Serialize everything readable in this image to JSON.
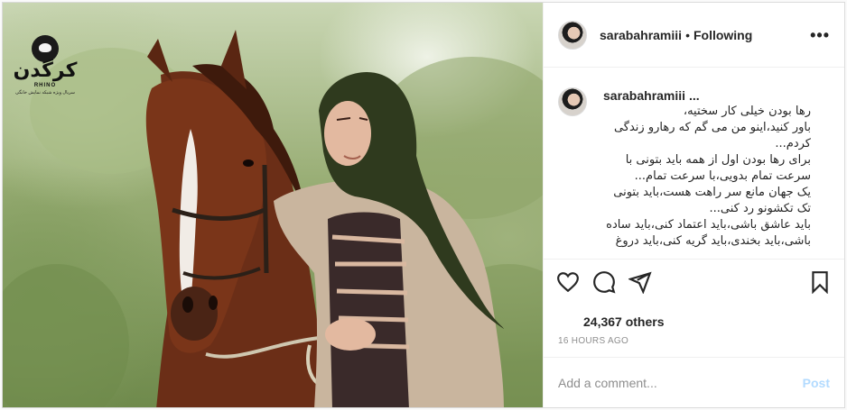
{
  "post": {
    "username": "sarabahramiii",
    "follow_status": "Following",
    "separator": "•",
    "more_icon": "more-horizontal-icon"
  },
  "logo": {
    "wordmark": "کرگدن",
    "subtitle": "RHINO",
    "tagline": "سریال ویژه شبکه نمایش خانگی"
  },
  "caption": {
    "username": "sarabahramiii ...",
    "lines": [
      "رها بودن خیلی کار سختیه،",
      "باور کنید،اینو من می گم که رهارو زندگی",
      "کردم...",
      "برای رها بودن اول از همه باید بتونی با",
      "سرعت تمام بدویی،با سرعت تمام...",
      "یک جهان مانع سر راهت هست،باید بتونی",
      "تک تکشونو رد کنی...",
      "باید عاشق باشی،باید اعتماد کنی،باید ساده",
      "باشی،باید بخندی،باید گریه کنی،باید دروغ"
    ]
  },
  "actions": {
    "like_icon": "heart-icon",
    "comment_icon": "comment-icon",
    "share_icon": "send-icon",
    "save_icon": "bookmark-icon"
  },
  "likes": "24,367 others",
  "timestamp": "16 HOURS AGO",
  "comment_box": {
    "placeholder": "Add a comment...",
    "post_label": "Post"
  },
  "colors": {
    "post_button_disabled": "#b3dbff",
    "muted_text": "#8e8e8e",
    "border": "#dbdbdb"
  }
}
